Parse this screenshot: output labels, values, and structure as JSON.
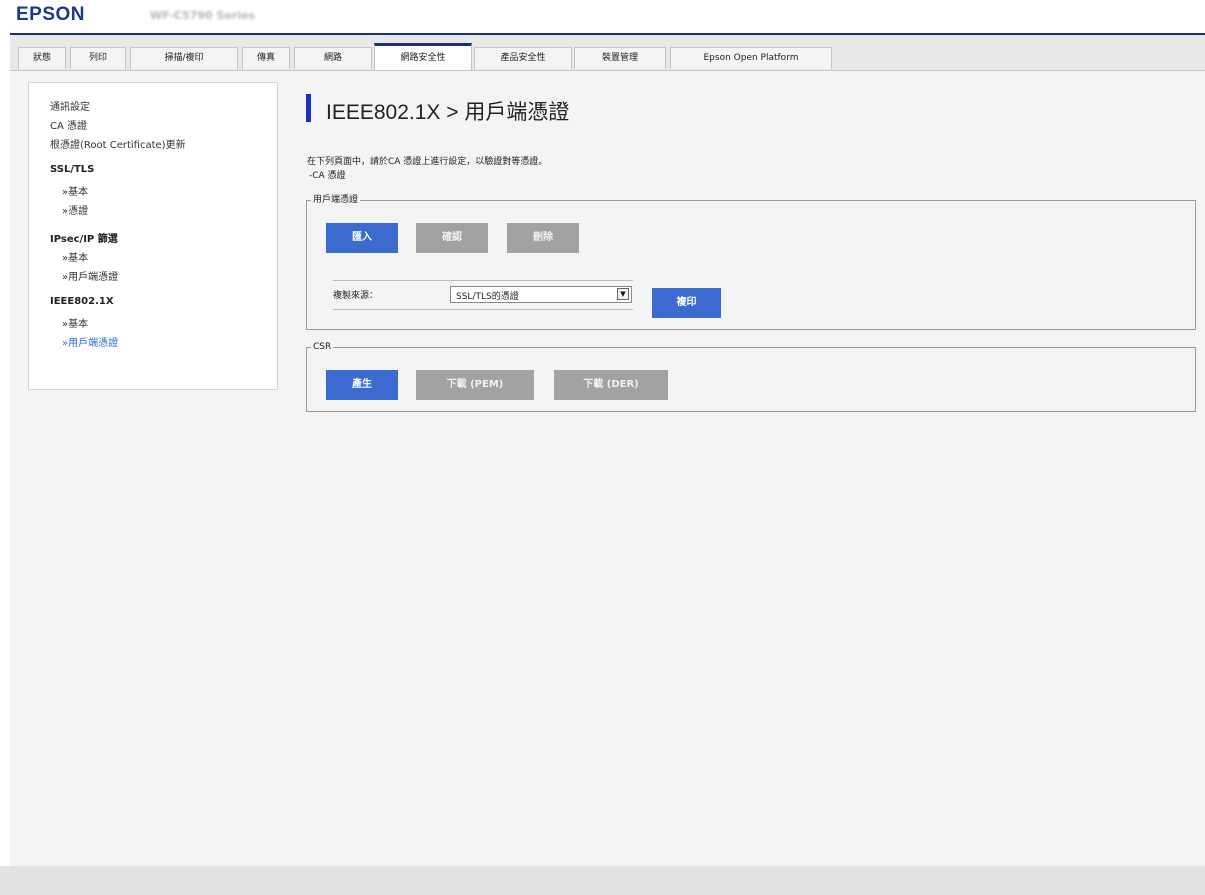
{
  "header": {
    "logo": "EPSON",
    "model": "WF-C5790 Series"
  },
  "tabs": [
    {
      "label": "狀態"
    },
    {
      "label": "列印"
    },
    {
      "label": "掃描/複印"
    },
    {
      "label": "傳真"
    },
    {
      "label": "網路"
    },
    {
      "label": "網路安全性"
    },
    {
      "label": "產品安全性"
    },
    {
      "label": "裝置管理"
    },
    {
      "label": "Epson Open Platform"
    }
  ],
  "sidebar": {
    "items": [
      {
        "label": "通訊設定"
      },
      {
        "label": "CA 憑證"
      },
      {
        "label": "根憑證(Root Certificate)更新"
      },
      {
        "label": "SSL/TLS"
      },
      {
        "label": "»基本"
      },
      {
        "label": "»憑證"
      },
      {
        "label": "IPsec/IP 篩選"
      },
      {
        "label": "»基本"
      },
      {
        "label": "»用戶端憑證"
      },
      {
        "label": "IEEE802.1X"
      },
      {
        "label": "»基本"
      },
      {
        "label": "»用戶端憑證"
      }
    ]
  },
  "content": {
    "title": "IEEE802.1X > 用戶端憑證",
    "desc_line1": "在下列頁面中，請於CA 憑證上進行設定，以驗證對等憑證。",
    "desc_line2": "-CA 憑證",
    "client_cert": {
      "legend": "用戶端憑證",
      "import_label": "匯入",
      "confirm_label": "確認",
      "delete_label": "刪除",
      "copy_source_label": "複製來源：",
      "copy_source_value": "SSL/TLS的憑證",
      "copy_label": "複印"
    },
    "csr": {
      "legend": "CSR",
      "generate_label": "產生",
      "download_pem_label": "下載 (PEM)",
      "download_der_label": "下載 (DER)"
    }
  },
  "colors": {
    "brand_navy": "#1b2f80",
    "primary_button": "#3c6bd0",
    "disabled_button": "#a2a2a2",
    "link_active": "#2d6bd6"
  }
}
